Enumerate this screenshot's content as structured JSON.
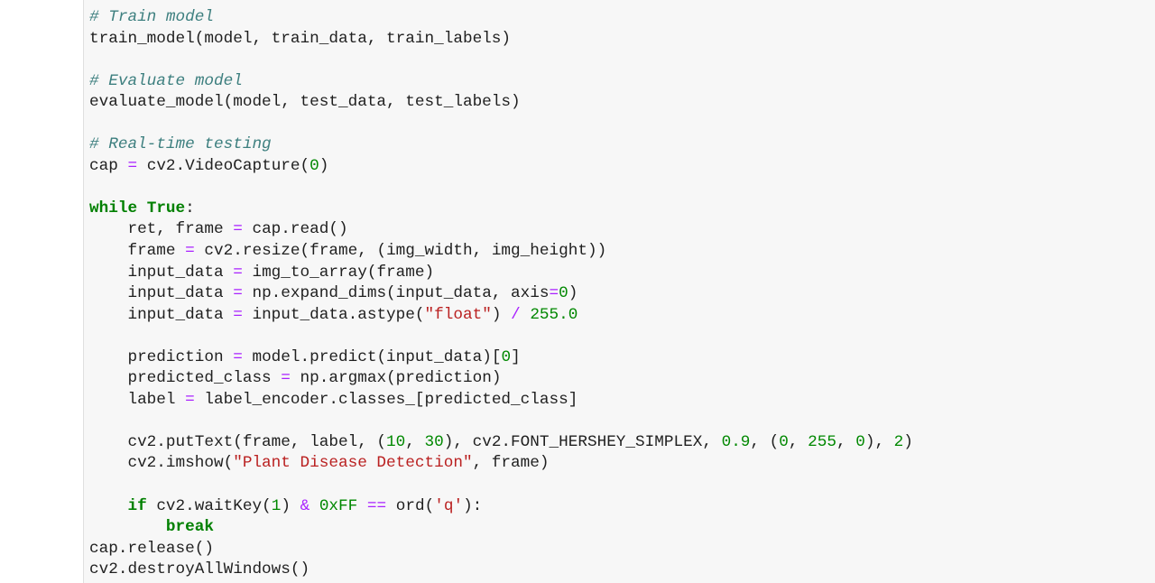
{
  "colors": {
    "comment": "#3d7f7f",
    "keyword": "#008000",
    "operator": "#aa22ff",
    "number": "#008800",
    "string": "#ba2121",
    "cell_background": "#f7f7f7"
  },
  "lines": [
    [
      [
        "# Train model",
        "comment"
      ]
    ],
    [
      [
        "train_model(model, train_data, train_labels)",
        ""
      ]
    ],
    [],
    [
      [
        "# Evaluate model",
        "comment"
      ]
    ],
    [
      [
        "evaluate_model(model, test_data, test_labels)",
        ""
      ]
    ],
    [],
    [
      [
        "# Real-time testing",
        "comment"
      ]
    ],
    [
      [
        "cap ",
        ""
      ],
      [
        "=",
        "op"
      ],
      [
        " cv2.VideoCapture(",
        ""
      ],
      [
        "0",
        "num"
      ],
      [
        ")",
        ""
      ]
    ],
    [],
    [
      [
        "while",
        "kw"
      ],
      [
        " ",
        ""
      ],
      [
        "True",
        "kw"
      ],
      [
        ":",
        ""
      ]
    ],
    [
      [
        "    ret, frame ",
        ""
      ],
      [
        "=",
        "op"
      ],
      [
        " cap.read()",
        ""
      ]
    ],
    [
      [
        "    frame ",
        ""
      ],
      [
        "=",
        "op"
      ],
      [
        " cv2.resize(frame, (img_width, img_height))",
        ""
      ]
    ],
    [
      [
        "    input_data ",
        ""
      ],
      [
        "=",
        "op"
      ],
      [
        " img_to_array(frame)",
        ""
      ]
    ],
    [
      [
        "    input_data ",
        ""
      ],
      [
        "=",
        "op"
      ],
      [
        " np.expand_dims(input_data, axis",
        ""
      ],
      [
        "=",
        "op"
      ],
      [
        "0",
        "num"
      ],
      [
        ")",
        ""
      ]
    ],
    [
      [
        "    input_data ",
        ""
      ],
      [
        "=",
        "op"
      ],
      [
        " input_data.astype(",
        ""
      ],
      [
        "\"float\"",
        "str"
      ],
      [
        ") ",
        ""
      ],
      [
        "/",
        "op"
      ],
      [
        " ",
        ""
      ],
      [
        "255.0",
        "num"
      ]
    ],
    [],
    [
      [
        "    prediction ",
        ""
      ],
      [
        "=",
        "op"
      ],
      [
        " model.predict(input_data)[",
        ""
      ],
      [
        "0",
        "num"
      ],
      [
        "]",
        ""
      ]
    ],
    [
      [
        "    predicted_class ",
        ""
      ],
      [
        "=",
        "op"
      ],
      [
        " np.argmax(prediction)",
        ""
      ]
    ],
    [
      [
        "    label ",
        ""
      ],
      [
        "=",
        "op"
      ],
      [
        " label_encoder.classes_[predicted_class]",
        ""
      ]
    ],
    [],
    [
      [
        "    cv2.putText(frame, label, (",
        ""
      ],
      [
        "10",
        "num"
      ],
      [
        ", ",
        ""
      ],
      [
        "30",
        "num"
      ],
      [
        "), cv2.FONT_HERSHEY_SIMPLEX, ",
        ""
      ],
      [
        "0.9",
        "num"
      ],
      [
        ", (",
        ""
      ],
      [
        "0",
        "num"
      ],
      [
        ", ",
        ""
      ],
      [
        "255",
        "num"
      ],
      [
        ", ",
        ""
      ],
      [
        "0",
        "num"
      ],
      [
        "), ",
        ""
      ],
      [
        "2",
        "num"
      ],
      [
        ")",
        ""
      ]
    ],
    [
      [
        "    cv2.imshow(",
        ""
      ],
      [
        "\"Plant Disease Detection\"",
        "str"
      ],
      [
        ", frame)",
        ""
      ]
    ],
    [],
    [
      [
        "    ",
        ""
      ],
      [
        "if",
        "kw"
      ],
      [
        " cv2.waitKey(",
        ""
      ],
      [
        "1",
        "num"
      ],
      [
        ") ",
        ""
      ],
      [
        "&",
        "op"
      ],
      [
        " ",
        ""
      ],
      [
        "0xFF",
        "num"
      ],
      [
        " ",
        ""
      ],
      [
        "==",
        "op"
      ],
      [
        " ord(",
        ""
      ],
      [
        "'q'",
        "str"
      ],
      [
        "):",
        ""
      ]
    ],
    [
      [
        "        ",
        ""
      ],
      [
        "break",
        "kw"
      ]
    ],
    [
      [
        "cap.release()",
        ""
      ]
    ],
    [
      [
        "cv2.destroyAllWindows()",
        ""
      ]
    ]
  ]
}
